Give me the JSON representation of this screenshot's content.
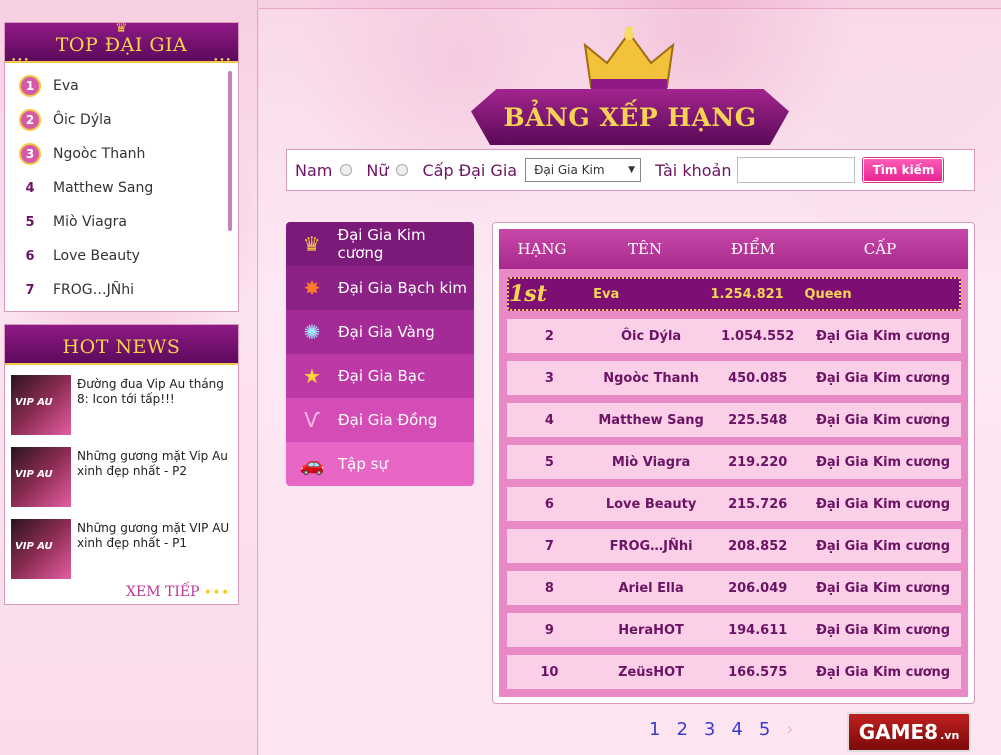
{
  "top_panel": {
    "title": "TOP ĐẠI GIA",
    "items": [
      {
        "rank": "1",
        "name": "Eva"
      },
      {
        "rank": "2",
        "name": "Ôic  Dýla"
      },
      {
        "rank": "3",
        "name": "Ngoòc Thanh"
      },
      {
        "rank": "4",
        "name": "Matthew Sang"
      },
      {
        "rank": "5",
        "name": "Miò Viagra"
      },
      {
        "rank": "6",
        "name": "Love Beauty"
      },
      {
        "rank": "7",
        "name": "FROG…JÑhi"
      }
    ]
  },
  "news_panel": {
    "title": "HOT NEWS",
    "items": [
      {
        "text": "Đường đua Vip Au tháng 8: Icon tới tấp!!!",
        "thumb_label": "VIP AU"
      },
      {
        "text": "Những gương mặt Vip Au xinh đẹp nhất - P2",
        "thumb_label": "VIP AU"
      },
      {
        "text": "Những gương mặt VIP AU xinh đẹp nhất - P1",
        "thumb_label": "VIP AU"
      }
    ],
    "more": "XEM TIẾP"
  },
  "title_banner": "BẢNG XẾP HẠNG",
  "search": {
    "male": "Nam",
    "female": "Nữ",
    "level_label": "Cấp Đại Gia",
    "level_selected": "Đại Gia Kim",
    "account_label": "Tài khoản",
    "account_value": "",
    "button": "Tìm kiếm"
  },
  "categories": [
    {
      "label": "Đại Gia Kim cương",
      "icon": "crown-icon",
      "color": "#7b1a78"
    },
    {
      "label": "Đại Gia Bạch kim",
      "icon": "star-burst-icon",
      "color": "#8c2186"
    },
    {
      "label": "Đại Gia Vàng",
      "icon": "sparkle-icon",
      "color": "#a42b95"
    },
    {
      "label": "Đại Gia Bạc",
      "icon": "star-icon",
      "color": "#bd3aa6"
    },
    {
      "label": "Đại Gia Đồng",
      "icon": "lv-logo-icon",
      "color": "#d44cb5"
    },
    {
      "label": "Tập sự",
      "icon": "car-icon",
      "color": "#e866c6"
    }
  ],
  "table": {
    "headers": [
      "HẠNG",
      "TÊN",
      "ĐIỂM",
      "CẤP"
    ],
    "first": {
      "rank": "1st",
      "name": "Eva",
      "score": "1.254.821",
      "level": "Queen"
    },
    "rows": [
      {
        "rank": "2",
        "name": "Ôic  Dýla",
        "score": "1.054.552",
        "level": "Đại Gia Kim cương"
      },
      {
        "rank": "3",
        "name": "Ngoòc Thanh",
        "score": "450.085",
        "level": "Đại Gia Kim cương"
      },
      {
        "rank": "4",
        "name": "Matthew Sang",
        "score": "225.548",
        "level": "Đại Gia Kim cương"
      },
      {
        "rank": "5",
        "name": "Miò Viagra",
        "score": "219.220",
        "level": "Đại Gia Kim cương"
      },
      {
        "rank": "6",
        "name": "Love Beauty",
        "score": "215.726",
        "level": "Đại Gia Kim cương"
      },
      {
        "rank": "7",
        "name": "FROG…JÑhi",
        "score": "208.852",
        "level": "Đại Gia Kim cương"
      },
      {
        "rank": "8",
        "name": "Ariel Ella",
        "score": "206.049",
        "level": "Đại Gia Kim cương"
      },
      {
        "rank": "9",
        "name": "HeraHOT",
        "score": "194.611",
        "level": "Đại Gia Kim cương"
      },
      {
        "rank": "10",
        "name": "ZeüsHOT",
        "score": "166.575",
        "level": "Đại Gia Kim cương"
      }
    ]
  },
  "paging": [
    "1",
    "2",
    "3",
    "4",
    "5"
  ],
  "paging_next": "›",
  "watermark": {
    "main": "GAME8",
    "suffix": ".vn"
  }
}
